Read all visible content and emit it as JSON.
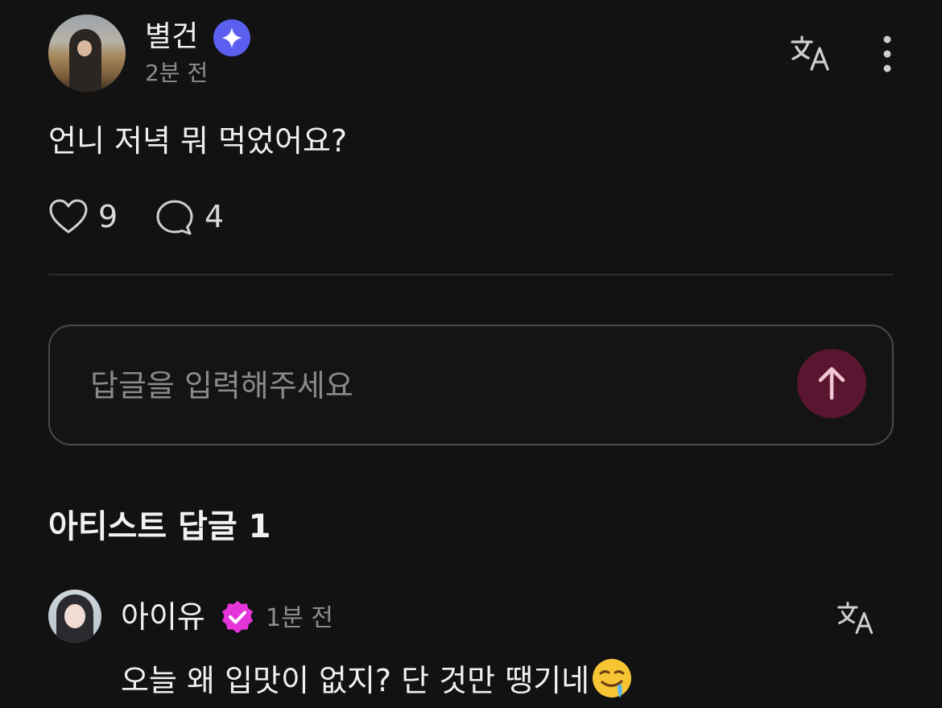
{
  "post": {
    "author": "별건",
    "time": "2분 전",
    "body": "언니 저녁 뭐 먹었어요?",
    "likes": "9",
    "comments": "4"
  },
  "reply_input": {
    "placeholder": "답글을 입력해주세요"
  },
  "artist_section": {
    "title": "아티스트 답글 1"
  },
  "artist_reply": {
    "author": "아이유",
    "time": "1분 전",
    "text": "오늘 왜 입맛이 없지? 단 것만 땡기네"
  },
  "colors": {
    "background": "#121212",
    "verified_blue": "#5b5ff0",
    "verified_pink": "#e534d8",
    "send_button": "#5a1630"
  },
  "icons": [
    "translate-icon",
    "more-vertical-icon",
    "heart-icon",
    "comment-icon",
    "arrow-up-icon",
    "verified-badge-icon",
    "drooling-face-emoji"
  ]
}
